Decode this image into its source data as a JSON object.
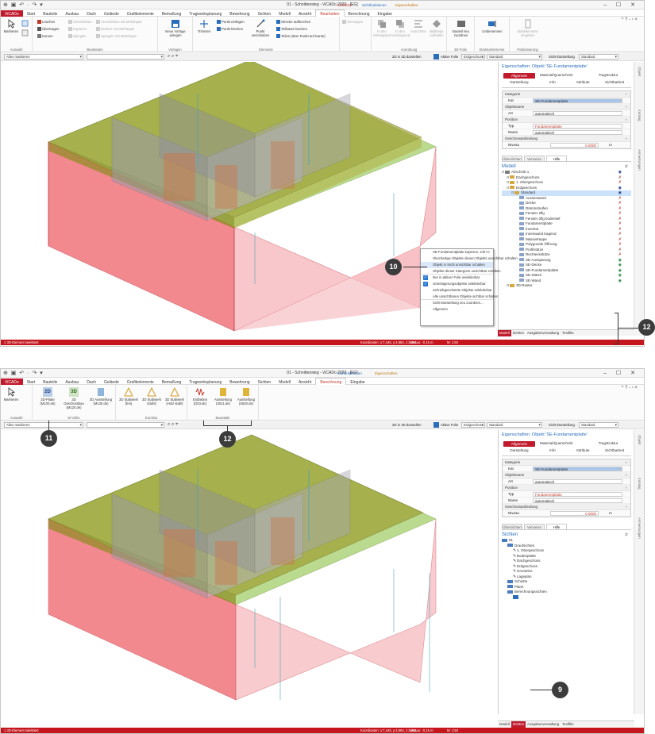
{
  "app_menu": "ViCADo",
  "title": "01 - Schnittensteg - ViCADo 2020 - [EG]",
  "window1": {
    "context_tabs": [
      "Selektion",
      "Sichtfunktionen",
      "Eigenschaften"
    ],
    "tabs": [
      "Start",
      "Bauteile",
      "Ausbau",
      "Dach",
      "Gelände",
      "Grafikelemente",
      "Bemaßung",
      "Tragwerksplanung",
      "Bewehrung",
      "Sichten",
      "Modell",
      "Ansicht",
      "Bearbeiten",
      "Berechnung",
      "Eingabe"
    ],
    "ribbon": {
      "markieren": "Markieren",
      "loeschen": "Löschen",
      "uebertragen": "Übertragen",
      "kurven": "Kurven",
      "verschieben": "Verschieben",
      "kopieren": "Kopieren",
      "spiegeln": "Spiegeln",
      "verschieben_mehrkopie": "Verschieben mit Mehrkopie",
      "drehen_mehrkopie": "Drehen mit Mehrkopie",
      "spiegeln_mehrkopie": "Spiegeln mit Mehrkopie",
      "neue_vorlage": "Neue Vorlage anlegen",
      "trimmen": "Trimmen",
      "punkt_einfuegen": "Punkt einfügen",
      "punkt_loeschen": "Punkt löschen",
      "punkt_verschieben": "Punkt verschieben",
      "strecke_aufbrechen": "Strecke aufbrechen",
      "teilkante_loeschen": "Teilkante löschen",
      "teilen": "Teilen (über Punkt auf Kante)",
      "vereinigen": "Vereinigen",
      "in_den_hintergrund": "In den Hintergrund",
      "in_den_vordergrund": "In den Vordergrund",
      "ausrichten": "Ausrichten",
      "bildlaenge": "Bildlänge einhalten",
      "bauteil_neu_zuordnen": "Bauteil neu zuordnen",
      "umbenennen": "Umbenennen",
      "stahlelemente": "Stahlelemente eingeben",
      "groups": [
        "Auswahl",
        "Bearbeiten",
        "Vorlagen",
        "Elemente",
        "Anordnung",
        "3D-Folie",
        "Strukturelemente",
        "Positionierung"
      ]
    },
    "sel_left": "Alles markieren",
    "sel_right": {
      "label": "2D in 3D darstellen",
      "aktive_folie": "Aktive Folie",
      "folie_value": "Erdgeschoss",
      "standard": "Standard",
      "sichtdarst": "Sicht-Darstellung",
      "sichtdarst_value": "Standard"
    }
  },
  "window2": {
    "context_tabs": [
      "Sichtfunktionen",
      "Eigenschaften"
    ],
    "tabs": [
      "Start",
      "Bauteile",
      "Ausbau",
      "Dach",
      "Gelände",
      "Grafikelemente",
      "Bemaßung",
      "Tragwerksplanung",
      "Bewehrung",
      "Sichten",
      "Modell",
      "Ansicht",
      "Berechnung",
      "Eingabe"
    ],
    "ribbon": {
      "markieren": "Markieren",
      "buttons": [
        {
          "label": "3D-Platte (M100.de)",
          "icon_text": "2D"
        },
        {
          "label": "3D Geschossbau (M120.de)",
          "icon_text": "3D"
        },
        {
          "label": "3D Aussteifung (M130.de)",
          "icon_text": ""
        },
        {
          "label": "3D Stabwerk (frei)",
          "icon_text": ""
        },
        {
          "label": "3D Stabwerk (stahl)",
          "icon_text": ""
        },
        {
          "label": "3D Stabwerk (Holz stahl)",
          "icon_text": ""
        },
        {
          "label": "Erdbeben (D03.de)",
          "icon_text": ""
        },
        {
          "label": "Aussteifung (S811.de)",
          "icon_text": ""
        },
        {
          "label": "Aussteifung (S820.de)",
          "icon_text": ""
        }
      ],
      "groups": [
        "Auswahl",
        "M-Volks",
        "EuroSta",
        "BauStatik"
      ]
    },
    "sel_left": "Alles markieren"
  },
  "properties": {
    "title": "Eigenschaften: Objekt 'SE-Fundamentplatte'",
    "tabs_row1": [
      "Allgemein",
      "Material/Querschnitt",
      "Tragstruktur"
    ],
    "tabs_row2": [
      "Darstellung",
      "Info",
      "Attribute",
      "Sichtbarkeit"
    ],
    "kategorie": "Kategorie",
    "kat_label": "Kat",
    "kat_value": "SE-Fundamentplatte",
    "objektname": "Objektname",
    "art_label": "Art",
    "art_value": "automatisch",
    "position": "Position",
    "typ_label": "Typ",
    "typ_value": "Fundamentplatte",
    "name_label": "Name",
    "name_value": "automatisch",
    "geschossanbindung": "Geschossanbindung",
    "niveau_label": "Niveau",
    "niveau_value": "0.0000",
    "niveau_unit": "m"
  },
  "bottom_panel_tabs": [
    "Übersichten",
    "Verweise",
    "Hilfe"
  ],
  "modell": {
    "header": "Modell",
    "items": [
      {
        "label": "Abschnitt 1",
        "indent": 0,
        "eye": "b"
      },
      {
        "label": "Dachgeschoss",
        "indent": 1,
        "eye": "r"
      },
      {
        "label": "1. Obergeschoss",
        "indent": 1,
        "eye": "r"
      },
      {
        "label": "Erdgeschoss",
        "indent": 1,
        "eye": "b"
      },
      {
        "label": "Standard",
        "indent": 2,
        "eye": "b",
        "hl": true
      },
      {
        "label": "Aussenwand",
        "indent": 3,
        "eye": "r"
      },
      {
        "label": "Decke",
        "indent": 3,
        "eye": "r"
      },
      {
        "label": "Dämmstreifen",
        "indent": 3,
        "eye": "r"
      },
      {
        "label": "Fenster 2flg",
        "indent": 3,
        "eye": "r"
      },
      {
        "label": "Fenster 2flg bodentief",
        "indent": 3,
        "eye": "r"
      },
      {
        "label": "Fundamentplatte",
        "indent": 3,
        "eye": "r"
      },
      {
        "label": "Innentür",
        "indent": 3,
        "eye": "r"
      },
      {
        "label": "Innenwand tragend",
        "indent": 3,
        "eye": "r"
      },
      {
        "label": "Massivtreppe",
        "indent": 3,
        "eye": "r"
      },
      {
        "label": "Polygonale Öffnung",
        "indent": 3,
        "eye": "r"
      },
      {
        "label": "Profilstütze",
        "indent": 3,
        "eye": "r"
      },
      {
        "label": "Rechteckstütze",
        "indent": 3,
        "eye": "r"
      },
      {
        "label": "SE-Aussparung",
        "indent": 3,
        "eye": "g"
      },
      {
        "label": "SE-Decke",
        "indent": 3,
        "eye": "g"
      },
      {
        "label": "SE-Fundamentplatte",
        "indent": 3,
        "eye": "g"
      },
      {
        "label": "SE-Stütze",
        "indent": 3,
        "eye": "g"
      },
      {
        "label": "SE-Wand",
        "indent": 3,
        "eye": "g"
      },
      {
        "label": "3D-Raster",
        "indent": 1,
        "eye": ""
      }
    ]
  },
  "context_menu": [
    {
      "label": "SE-Fundamentplatte kopieren...",
      "shortcut": "Ctrl+C"
    },
    {
      "label": "Gleichartige Objekte diesen Objekts unsichtbar schalten"
    },
    {
      "label": "Objekt in Sicht unsichtbar schalten",
      "hl": true
    },
    {
      "label": "Objekte dieser Kategorie unsichtbar schalten",
      "sep": true
    },
    {
      "label": "Nur in aktiver Folie selektierbar",
      "check": true
    },
    {
      "label": "Unterlagerungsobjekte selektierbar",
      "check": true
    },
    {
      "label": "Schreibgeschützte Objekte selektierbar"
    },
    {
      "label": "Alle unsichtbaren Objekte sichtbar schalten",
      "sep": true
    },
    {
      "label": "Sicht-Darstellung neu zuordnen..."
    },
    {
      "label": "Allgemein"
    }
  ],
  "sichten": {
    "header": "Sichten",
    "items": [
      {
        "label": "81",
        "indent": 0,
        "kind": "folder"
      },
      {
        "label": "Draufsichten",
        "indent": 1,
        "kind": "folder"
      },
      {
        "label": "1. Obergeschoss",
        "indent": 2,
        "kind": "pen"
      },
      {
        "label": "Bodenplatte",
        "indent": 2,
        "kind": "pen"
      },
      {
        "label": "Dachgeschoss",
        "indent": 2,
        "kind": "pen"
      },
      {
        "label": "Erdgeschoss",
        "indent": 2,
        "kind": "pen"
      },
      {
        "label": "Grundriss",
        "indent": 2,
        "kind": "pen"
      },
      {
        "label": "Lageplan",
        "indent": 2,
        "kind": "pen"
      },
      {
        "label": "Schnitte",
        "indent": 1,
        "kind": "folder"
      },
      {
        "label": "Pläne",
        "indent": 1,
        "kind": "folder"
      },
      {
        "label": "Berechnungssichten",
        "indent": 1,
        "kind": "folder"
      },
      {
        "label": "",
        "indent": 2,
        "kind": "sel"
      }
    ]
  },
  "bottom_tabs_w1": [
    "Modell",
    "Sichten",
    "Ausgabenverwaltung",
    "Textfilte"
  ],
  "bottom_tabs_w2": [
    "Modell",
    "Sichten",
    "Ausgabenverwaltung",
    "Textfilte"
  ],
  "status1": {
    "left": "1 3D-Element selektiert",
    "coords": "Koordinaten: x:7,445, y:4,984, z:2,461",
    "niveau": "Niveau: -0,15 m",
    "massstab": "M: 1:50"
  },
  "status2": {
    "left": "1 3D-Element selektiert",
    "coords": "Koordinaten: x:7,445, y:4,984, z:2,461",
    "niveau": "Niveau: -0,15 m",
    "massstab": "M: 1:50"
  },
  "vstrip": [
    "Objekt",
    "Katalog",
    "Anmerkungen"
  ],
  "callouts": {
    "c10": "10",
    "c11": "11",
    "c12": "12",
    "c9": "9",
    "c12b": "12"
  },
  "colors": {
    "brand": "#c01a2c",
    "accent_blue": "#2a6ebb",
    "wall_red": "#e84a55",
    "olive": "#8c8a1e",
    "green": "#9ecb5a"
  }
}
